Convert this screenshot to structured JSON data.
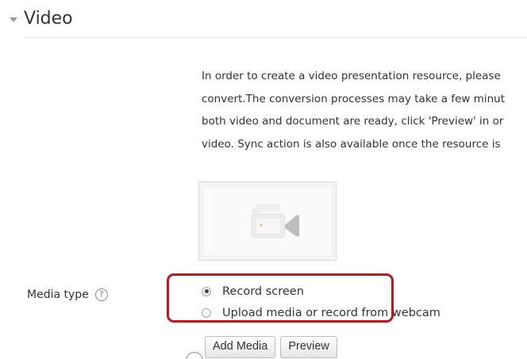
{
  "section": {
    "title": "Video",
    "toggle_icon": "chevron-down-icon"
  },
  "instructions": {
    "lines": [
      "In order to create a video presentation resource, please",
      "convert.The conversion processes may take a few minut",
      "both video and document are ready, click 'Preview' in or",
      "video. Sync action is also available once the resource is"
    ]
  },
  "video_placeholder": {
    "icon": "video-camera-icon"
  },
  "media_type": {
    "label": "Media type",
    "help_icon_glyph": "?",
    "options": [
      {
        "label": "Record screen",
        "checked": true
      },
      {
        "label": "Upload media or record from webcam",
        "checked": false
      }
    ]
  },
  "buttons": {
    "add_media": "Add Media",
    "preview": "Preview"
  },
  "colors": {
    "highlight": "#c0161f",
    "text": "#333333",
    "divider": "#e3e3e3"
  }
}
